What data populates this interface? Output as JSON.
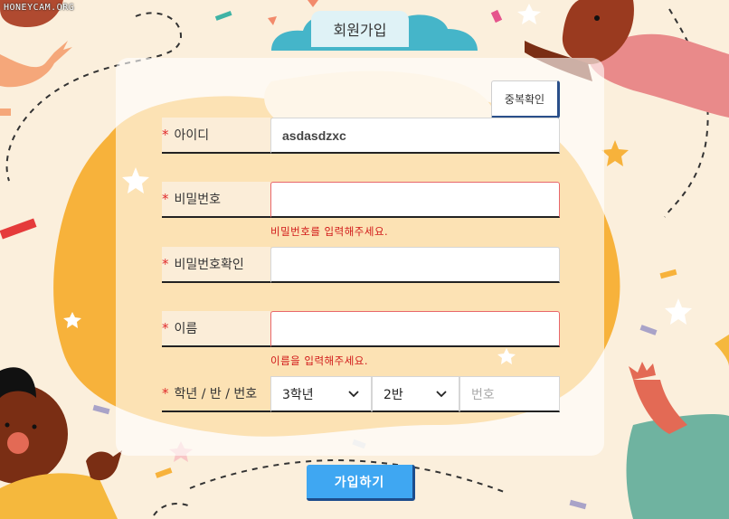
{
  "watermark": "HONEYCAM.ORG",
  "title": "회원가입",
  "dup_check_label": "중복확인",
  "required_mark": "*",
  "fields": {
    "id": {
      "label": "아이디",
      "value": "asdasdzxc"
    },
    "password": {
      "label": "비밀번호",
      "value": "",
      "error": "비밀번호를 입력해주세요."
    },
    "password_confirm": {
      "label": "비밀번호확인",
      "value": ""
    },
    "name": {
      "label": "이름",
      "value": "",
      "error": "이름을 입력해주세요."
    },
    "grade_class_number": {
      "label": "학년 / 반 / 번호",
      "grade_selected": "3학년",
      "class_selected": "2반",
      "number_placeholder": "번호"
    }
  },
  "submit_label": "가입하기",
  "colors": {
    "accent": "#3fa7f2",
    "error": "#d11a1a",
    "background": "#fbefdc",
    "blob_yellow": "#f7b23b",
    "cloud": "#45b5c9"
  }
}
